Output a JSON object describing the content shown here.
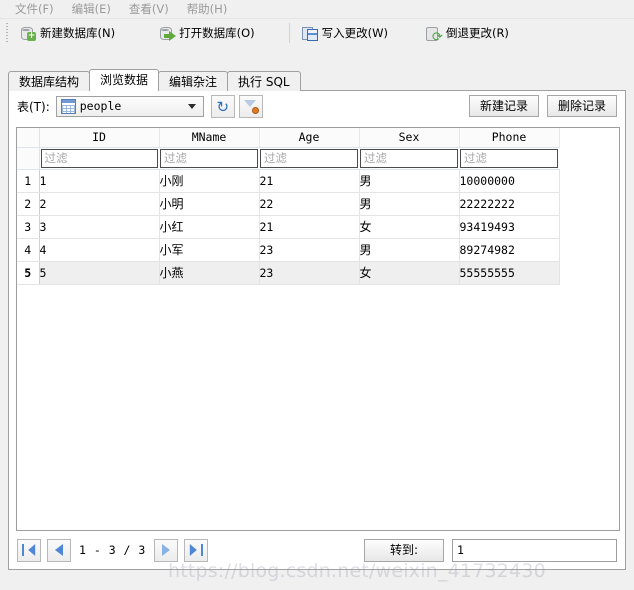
{
  "menu": {
    "items": [
      {
        "label": "文件(F)",
        "name": "menu-file"
      },
      {
        "label": "编辑(E)",
        "name": "menu-edit"
      },
      {
        "label": "查看(V)",
        "name": "menu-view"
      },
      {
        "label": "帮助(H)",
        "name": "menu-help"
      }
    ]
  },
  "toolbar": {
    "new_db": "新建数据库(N)",
    "open_db": "打开数据库(O)",
    "write_changes": "写入更改(W)",
    "revert_changes": "倒退更改(R)",
    "icons": {
      "new_db": "database-add-icon",
      "open_db": "database-open-icon",
      "write_changes": "save-icon",
      "revert_changes": "revert-icon"
    }
  },
  "tabs": [
    {
      "label": "数据库结构",
      "active": false
    },
    {
      "label": "浏览数据",
      "active": true
    },
    {
      "label": "编辑杂注",
      "active": false
    },
    {
      "label": "执行 SQL",
      "active": false
    }
  ],
  "chooser": {
    "table_label": "表(T):",
    "selected_table": "people",
    "table_icon": "table-icon",
    "dropdown_icon": "chevron-down-icon",
    "refresh_icon": "refresh-icon",
    "clear_filter_icon": "clear-filter-icon",
    "new_record": "新建记录",
    "delete_record": "删除记录"
  },
  "grid": {
    "columns": [
      "ID",
      "MName",
      "Age",
      "Sex",
      "Phone"
    ],
    "filter_placeholder": "过滤",
    "filter_values": [
      "",
      "",
      "",
      "",
      ""
    ],
    "rows": [
      {
        "n": "1",
        "cells": [
          "1",
          "小刚",
          "21",
          "男",
          "10000000"
        ],
        "selected": false
      },
      {
        "n": "2",
        "cells": [
          "2",
          "小明",
          "22",
          "男",
          "22222222"
        ],
        "selected": false
      },
      {
        "n": "3",
        "cells": [
          "3",
          "小红",
          "21",
          "女",
          "93419493"
        ],
        "selected": false
      },
      {
        "n": "4",
        "cells": [
          "4",
          "小军",
          "23",
          "男",
          "89274982"
        ],
        "selected": false
      },
      {
        "n": "5",
        "cells": [
          "5",
          "小燕",
          "23",
          "女",
          "55555555"
        ],
        "selected": true
      }
    ]
  },
  "pager": {
    "first_icon": "first-page-icon",
    "prev_icon": "prev-page-icon",
    "next_icon": "next-page-icon",
    "last_icon": "last-page-icon",
    "page_info": "1 - 3 / 3",
    "goto_label": "转到:",
    "goto_value": "1"
  },
  "watermark": "https://blog.csdn.net/weixin_41732430",
  "colors": {
    "window_bg": "#f0f0f0",
    "panel_bg": "#ffffff",
    "accent_blue": "#4f86d6",
    "selected_row": "#efefef",
    "menu_text": "#9a9a9a"
  }
}
